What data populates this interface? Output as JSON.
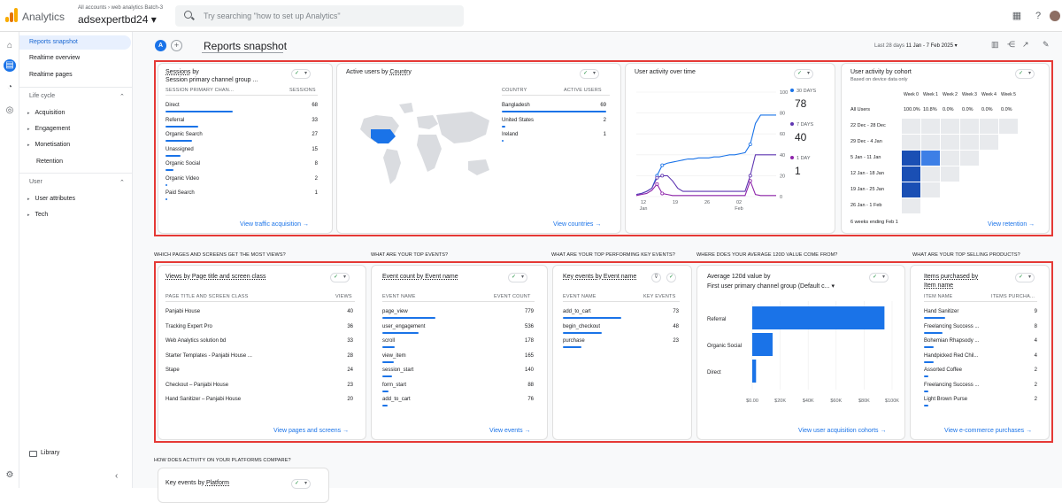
{
  "app": {
    "name": "Analytics",
    "account_path": "All accounts › web analytics Batch-3",
    "property": "adsexpertbd24 ▾"
  },
  "search": {
    "placeholder": "Try searching \"how to set up Analytics\""
  },
  "colors": {
    "accent": "#1a73e8",
    "highlight": "#e53935",
    "logo": [
      "#f9ab00",
      "#e37400",
      "#f9ab00"
    ]
  },
  "nav": {
    "reports_snapshot": "Reports snapshot",
    "realtime_overview": "Realtime overview",
    "realtime_pages": "Realtime pages",
    "lifecycle": "Life cycle",
    "acquisition": "Acquisition",
    "engagement": "Engagement",
    "monetisation": "Monetisation",
    "retention": "Retention",
    "user": "User",
    "user_attributes": "User attributes",
    "tech": "Tech",
    "library": "Library"
  },
  "header": {
    "title": "Reports snapshot",
    "avatar": "A",
    "add": "+",
    "date_label": "Last 28 days",
    "date_range": "11 Jan - 7 Feb 2025 ▾"
  },
  "sessions_card": {
    "title_a": "Sessions",
    "title_b": " by",
    "title_c": "Session primary channel group ...",
    "col1": "SESSION PRIMARY CHAN...",
    "col2": "SESSIONS",
    "rows": [
      {
        "label": "Direct",
        "value": "68",
        "pct": 1.0
      },
      {
        "label": "Referral",
        "value": "33",
        "pct": 0.49
      },
      {
        "label": "Organic Search",
        "value": "27",
        "pct": 0.4
      },
      {
        "label": "Unassigned",
        "value": "15",
        "pct": 0.22
      },
      {
        "label": "Organic Social",
        "value": "8",
        "pct": 0.12
      },
      {
        "label": "Organic Video",
        "value": "2",
        "pct": 0.03
      },
      {
        "label": "Paid Search",
        "value": "1",
        "pct": 0.015
      }
    ],
    "link": "View traffic acquisition →"
  },
  "active_users_card": {
    "title_a": "Active users",
    "title_b": " by ",
    "title_c": "Country",
    "col1": "COUNTRY",
    "col2": "ACTIVE USERS",
    "rows": [
      {
        "label": "Bangladesh",
        "value": "69",
        "pct": 1.0
      },
      {
        "label": "United States",
        "value": "2",
        "pct": 0.03
      },
      {
        "label": "Ireland",
        "value": "1",
        "pct": 0.015
      }
    ],
    "link": "View countries →"
  },
  "activity_card": {
    "title": "User activity over time",
    "legend": [
      {
        "label": "30 DAYS",
        "value": "78",
        "color": "#1a73e8"
      },
      {
        "label": "7 DAYS",
        "value": "40",
        "color": "#5e35b1"
      },
      {
        "label": "1 DAY",
        "value": "1",
        "color": "#8e24aa"
      }
    ]
  },
  "cohort_card": {
    "title": "User activity by cohort",
    "subtitle": "Based on device data only",
    "weeks": [
      "Week 0",
      "Week 1",
      "Week 2",
      "Week 3",
      "Week 4",
      "Week 5"
    ],
    "all_users": {
      "label": "All Users",
      "values": [
        "100.0%",
        "10.8%",
        "0.0%",
        "0.0%",
        "0.0%",
        "0.0%"
      ]
    },
    "rows": [
      {
        "label": "22 Dec - 28 Dec"
      },
      {
        "label": "29 Dec - 4 Jan"
      },
      {
        "label": "5 Jan - 11 Jan"
      },
      {
        "label": "12 Jan - 18 Jan"
      },
      {
        "label": "19 Jan - 25 Jan"
      },
      {
        "label": "26 Jan - 1 Feb"
      }
    ],
    "footer": "6 weeks ending Feb 1",
    "link": "View retention →"
  },
  "questions": {
    "q1": "WHICH PAGES AND SCREENS GET THE MOST VIEWS?",
    "q2": "WHAT ARE YOUR TOP EVENTS?",
    "q3": "WHAT ARE YOUR TOP PERFORMING KEY EVENTS?",
    "q4": "WHERE DOES YOUR AVERAGE 120D VALUE COME FROM?",
    "q5": "WHAT ARE YOUR TOP SELLING PRODUCTS?",
    "q6": "HOW DOES ACTIVITY ON YOUR PLATFORMS COMPARE?"
  },
  "views_card": {
    "title": "Views by Page title and screen class",
    "col1": "PAGE TITLE AND SCREEN CLASS",
    "col2": "VIEWS",
    "rows": [
      {
        "label": "Panjabi House",
        "value": "40"
      },
      {
        "label": "Tracking Expert Pro",
        "value": "36"
      },
      {
        "label": "Web Analytics solution bd",
        "value": "33"
      },
      {
        "label": "Starter Templates - Panjabi House ...",
        "value": "28"
      },
      {
        "label": "Stape",
        "value": "24"
      },
      {
        "label": "Checkout – Panjabi House",
        "value": "23"
      },
      {
        "label": "Hand Sanitizer – Panjabi House",
        "value": "20"
      }
    ],
    "link": "View pages and screens →"
  },
  "events_card": {
    "title": "Event count by Event name",
    "col1": "EVENT NAME",
    "col2": "EVENT COUNT",
    "rows": [
      {
        "label": "page_view",
        "value": "779",
        "pct": 1.0
      },
      {
        "label": "user_engagement",
        "value": "536",
        "pct": 0.69
      },
      {
        "label": "scroll",
        "value": "178",
        "pct": 0.23
      },
      {
        "label": "view_item",
        "value": "165",
        "pct": 0.21
      },
      {
        "label": "session_start",
        "value": "140",
        "pct": 0.18
      },
      {
        "label": "form_start",
        "value": "88",
        "pct": 0.11
      },
      {
        "label": "add_to_cart",
        "value": "76",
        "pct": 0.1
      }
    ],
    "link": "View events →"
  },
  "key_events_card": {
    "title": "Key events by Event name",
    "col1": "EVENT NAME",
    "col2": "KEY EVENTS",
    "rows": [
      {
        "label": "add_to_cart",
        "value": "73",
        "pct": 1.0
      },
      {
        "label": "begin_checkout",
        "value": "48",
        "pct": 0.66
      },
      {
        "label": "purchase",
        "value": "23",
        "pct": 0.32
      }
    ]
  },
  "avg_value_card": {
    "title_a": "Average 120d value by",
    "title_b": "First user primary channel group (Default c... ▾",
    "link": "View user acquisition cohorts →"
  },
  "products_card": {
    "title_a": "Items purchased by",
    "title_b": "Item name",
    "col1": "ITEM NAME",
    "col2": "ITEMS PURCHA...",
    "rows": [
      {
        "label": "Hand Sanitizer",
        "value": "9",
        "pct": 1.0
      },
      {
        "label": "Freelancing Success ...",
        "value": "8",
        "pct": 0.89
      },
      {
        "label": "Bohemian Rhapsody ...",
        "value": "4",
        "pct": 0.44
      },
      {
        "label": "Handpicked Red Chil...",
        "value": "4",
        "pct": 0.44
      },
      {
        "label": "Assorted Coffee",
        "value": "2",
        "pct": 0.22
      },
      {
        "label": "Freelancing Success ...",
        "value": "2",
        "pct": 0.22
      },
      {
        "label": "Light Brown Purse",
        "value": "2",
        "pct": 0.22
      }
    ],
    "link": "View e-commerce purchases →"
  },
  "platform_card": {
    "title_a": "Key events",
    "title_b": " by ",
    "title_c": "Platform"
  },
  "chart_data": [
    {
      "type": "line",
      "title": "User activity over time",
      "x_ticks": [
        "12 Jan",
        "19",
        "26",
        "02 Feb",
        "Feb"
      ],
      "y_ticks": [
        "0",
        "20",
        "40",
        "60",
        "80",
        "100"
      ],
      "ylim": [
        0,
        100
      ],
      "series": [
        {
          "name": "30 DAYS",
          "values": [
            2,
            3,
            5,
            8,
            20,
            30,
            32,
            33,
            34,
            35,
            36,
            36,
            37,
            37,
            37,
            38,
            38,
            39,
            40,
            40,
            41,
            42,
            50,
            70,
            78,
            78,
            78,
            78
          ]
        },
        {
          "name": "7 DAYS",
          "values": [
            2,
            3,
            5,
            8,
            18,
            20,
            20,
            15,
            8,
            5,
            5,
            5,
            5,
            5,
            5,
            5,
            5,
            5,
            5,
            5,
            5,
            5,
            20,
            40,
            40,
            40,
            40,
            40
          ]
        },
        {
          "name": "1 DAY",
          "values": [
            1,
            2,
            3,
            6,
            12,
            3,
            2,
            1,
            1,
            1,
            1,
            1,
            1,
            1,
            1,
            1,
            1,
            1,
            1,
            1,
            1,
            1,
            15,
            2,
            1,
            1,
            1,
            1
          ]
        }
      ]
    },
    {
      "type": "bar",
      "title": "Average 120d value by First user primary channel group (Default c...",
      "orientation": "horizontal",
      "categories": [
        "Referral",
        "Organic Social",
        "Direct"
      ],
      "values": [
        5200,
        800,
        150
      ],
      "x_ticks": [
        "$0.00",
        "$20K",
        "$40K",
        "$60K",
        "$80K",
        "$100K"
      ],
      "xlim": [
        0,
        5500
      ]
    }
  ]
}
